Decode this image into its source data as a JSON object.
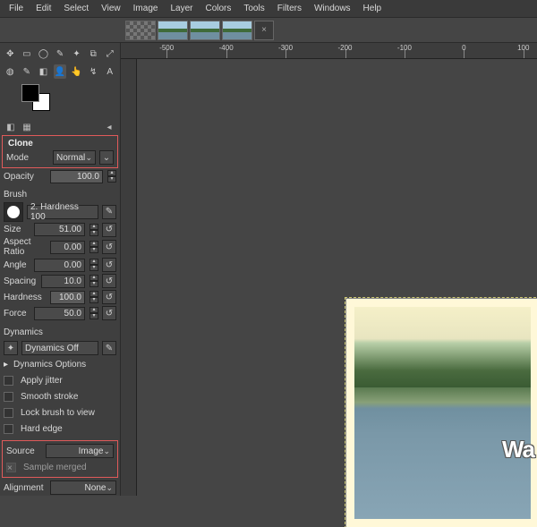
{
  "menu": [
    "File",
    "Edit",
    "Select",
    "View",
    "Image",
    "Layer",
    "Colors",
    "Tools",
    "Filters",
    "Windows",
    "Help"
  ],
  "ruler_ticks": [
    "-500",
    "-400",
    "-300",
    "-200",
    "-100",
    "0",
    "100"
  ],
  "tool_title": "Clone",
  "mode": {
    "label": "Mode",
    "value": "Normal"
  },
  "opacity": {
    "label": "Opacity",
    "value": "100.0"
  },
  "brush": {
    "label": "Brush",
    "name": "2. Hardness 100"
  },
  "size": {
    "label": "Size",
    "value": "51.00"
  },
  "aspect": {
    "label": "Aspect Ratio",
    "value": "0.00"
  },
  "angle": {
    "label": "Angle",
    "value": "0.00"
  },
  "spacing": {
    "label": "Spacing",
    "value": "10.0"
  },
  "hardness": {
    "label": "Hardness",
    "value": "100.0"
  },
  "force": {
    "label": "Force",
    "value": "50.0"
  },
  "dynamics": {
    "label": "Dynamics",
    "value": "Dynamics Off",
    "options": "Dynamics Options"
  },
  "checks": {
    "jitter": "Apply jitter",
    "smooth": "Smooth stroke",
    "lock": "Lock brush to view",
    "hard": "Hard edge"
  },
  "source": {
    "label": "Source",
    "value": "Image",
    "merged": "Sample merged"
  },
  "alignment": {
    "label": "Alignment",
    "value": "None"
  },
  "watermark": "Wa"
}
